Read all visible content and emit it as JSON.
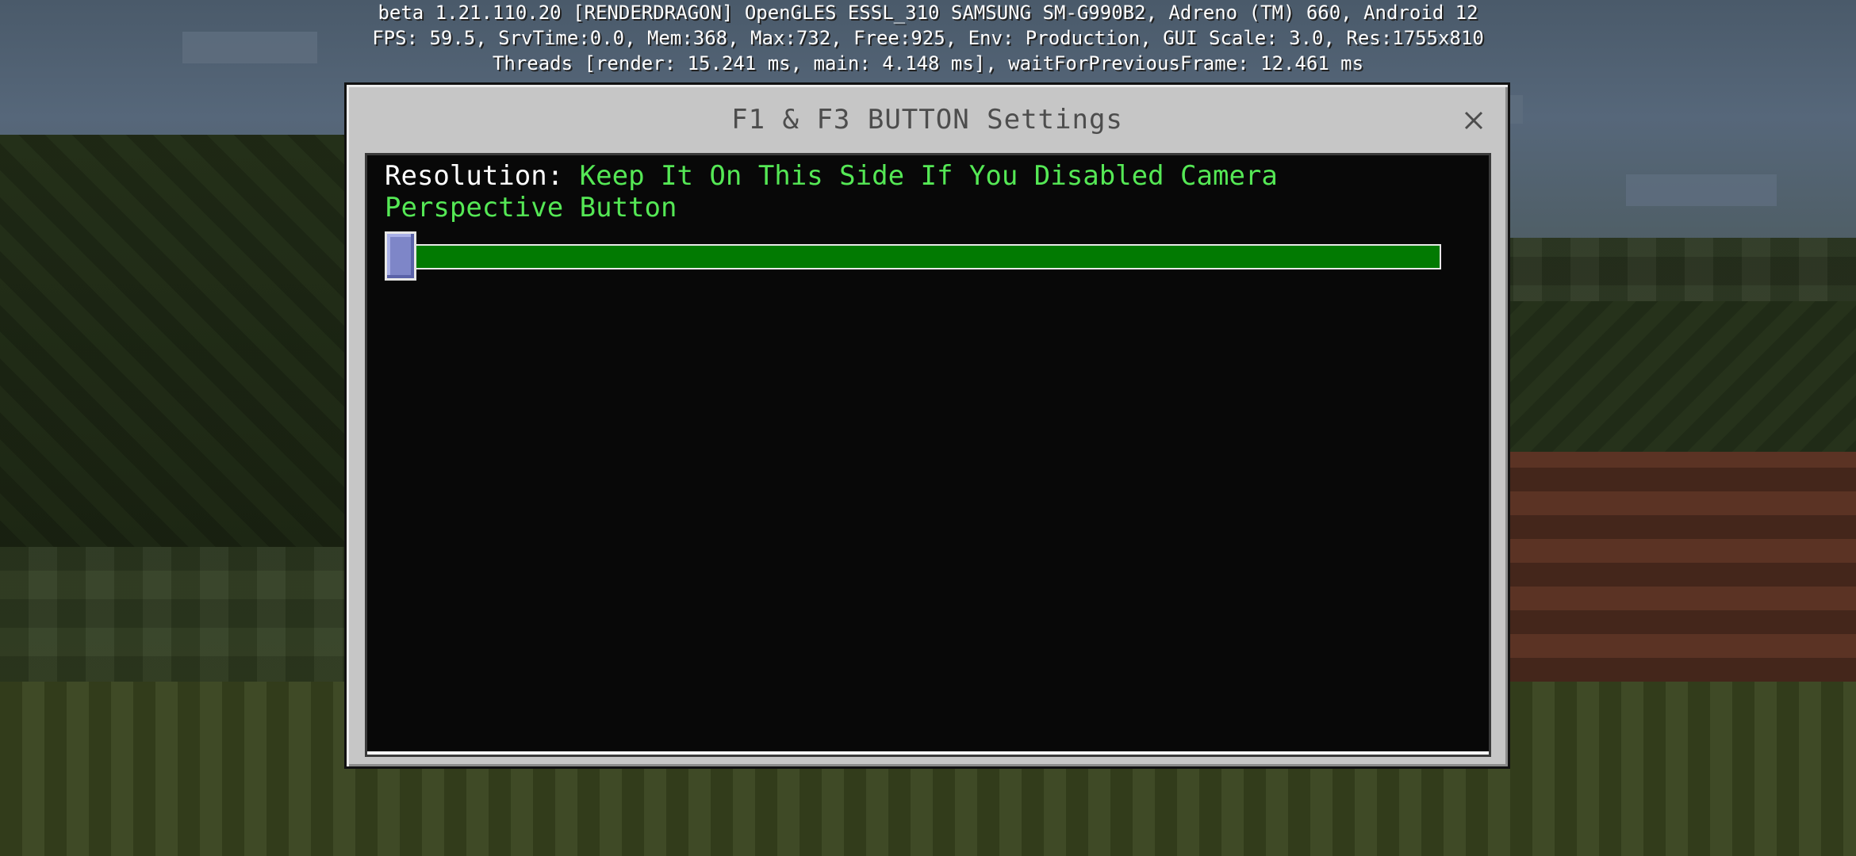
{
  "debug": {
    "line1": "beta 1.21.110.20 [RENDERDRAGON] OpenGLES ESSL_310 SAMSUNG SM-G990B2, Adreno (TM) 660, Android 12",
    "line2": "FPS: 59.5, SrvTime:0.0, Mem:368, Max:732, Free:925, Env: Production, GUI Scale: 3.0, Res:1755x810",
    "line3": "Threads [render: 15.241 ms, main: 4.148 ms], waitForPreviousFrame: 12.461 ms"
  },
  "dialog": {
    "title": "F1 & F3 BUTTON Settings",
    "close_icon": "close-icon"
  },
  "setting": {
    "key_label": "Resolution:",
    "value_label": "Keep It On This Side If You Disabled Camera Perspective Button",
    "slider_value": 0.0
  },
  "colors": {
    "label_value": "#55e855",
    "slider_fill": "#027a02",
    "slider_thumb": "#7e86c8"
  }
}
